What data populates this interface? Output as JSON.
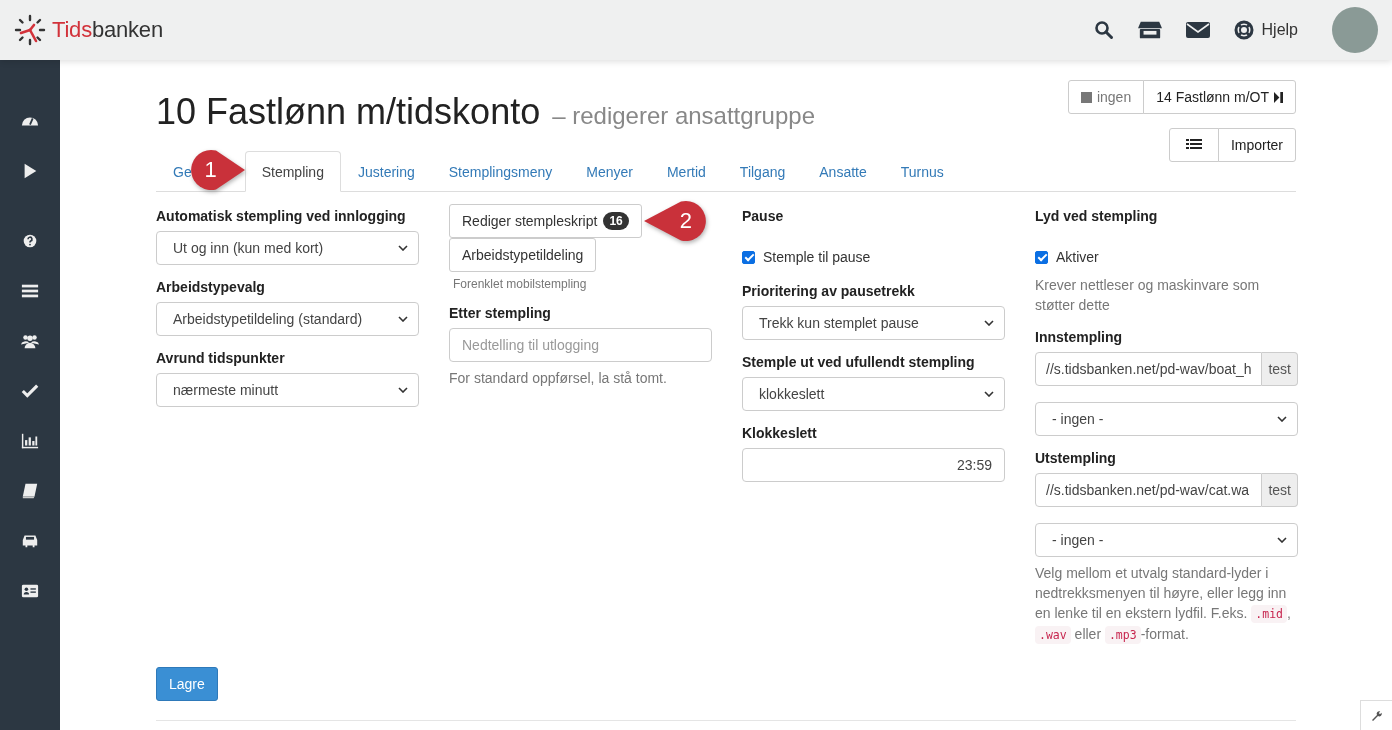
{
  "header": {
    "brand_first": "Tids",
    "brand_rest": "banken",
    "help": "Hjelp"
  },
  "page": {
    "title": "10 Fastlønn m/tidskonto",
    "subtitle": "– redigerer ansattgruppe",
    "prev": "ingen",
    "next": "14 Fastlønn m/OT",
    "import": "Importer"
  },
  "tabs": [
    {
      "label": "Ge",
      "selected": false
    },
    {
      "label": "Stempling",
      "selected": true
    },
    {
      "label": "Justering",
      "selected": false
    },
    {
      "label": "Stemplingsmeny",
      "selected": false
    },
    {
      "label": "Menyer",
      "selected": false
    },
    {
      "label": "Mertid",
      "selected": false
    },
    {
      "label": "Tilgang",
      "selected": false
    },
    {
      "label": "Ansatte",
      "selected": false
    },
    {
      "label": "Turnus",
      "selected": false
    }
  ],
  "callouts": [
    {
      "label": "1"
    },
    {
      "label": "2"
    }
  ],
  "columns": [
    [
      {
        "kind": "heading",
        "text": "Automatisk stempling ved innlogging"
      },
      {
        "kind": "select",
        "value": "Ut og inn (kun med kort)"
      },
      {
        "kind": "heading",
        "text": "Arbeidstypevalg"
      },
      {
        "kind": "select",
        "value": "Arbeidstypetildeling (standard)"
      },
      {
        "kind": "heading",
        "text": "Avrund tidspunkter"
      },
      {
        "kind": "select",
        "value": "nærmeste minutt"
      }
    ],
    [
      {
        "kind": "button",
        "label": "Rediger stempleskript",
        "badge": "16"
      },
      {
        "kind": "button",
        "label": "Arbeidstypetildeling"
      },
      {
        "kind": "small",
        "text": "Forenklet mobilstempling"
      },
      {
        "kind": "heading",
        "text": "Etter stempling"
      },
      {
        "kind": "input",
        "placeholder": "Nedtelling til utlogging"
      },
      {
        "kind": "note",
        "text": "For standard oppførsel, la stå tomt."
      }
    ],
    [
      {
        "kind": "heading",
        "text": "Pause"
      },
      {
        "kind": "checkbox",
        "label": "Stemple til pause",
        "checked": true
      },
      {
        "kind": "heading",
        "text": "Prioritering av pausetrekk"
      },
      {
        "kind": "select",
        "value": "Trekk kun stemplet pause"
      },
      {
        "kind": "heading",
        "text": "Stemple ut ved ufullendt stempling"
      },
      {
        "kind": "select",
        "value": "klokkeslett"
      },
      {
        "kind": "heading",
        "text": "Klokkeslett"
      },
      {
        "kind": "time",
        "value": "23:59"
      }
    ],
    [
      {
        "kind": "heading",
        "text": "Lyd ved stempling"
      },
      {
        "kind": "checkbox",
        "label": "Aktiver",
        "checked": true
      },
      {
        "kind": "note",
        "text": "Krever nettleser og maskinvare som støtter dette"
      },
      {
        "kind": "heading",
        "text": "Innstempling"
      },
      {
        "kind": "url",
        "value": "//s.tidsbanken.net/pd-wav/boat_h",
        "addon": "test"
      },
      {
        "kind": "select",
        "value": "- ingen -"
      },
      {
        "kind": "heading",
        "text": "Utstempling"
      },
      {
        "kind": "url",
        "value": "//s.tidsbanken.net/pd-wav/cat.wa",
        "addon": "test"
      },
      {
        "kind": "select",
        "value": "- ingen -"
      },
      {
        "kind": "parts",
        "parts": [
          {
            "kind": "text",
            "text": "Velg mellom et utvalg standard-lyder i nedtrekksmenyen til høyre, eller legg inn en lenke til en ekstern lydfil. F.eks. "
          },
          {
            "kind": "code",
            "text": ".mid"
          },
          {
            "kind": "text",
            "text": ", "
          },
          {
            "kind": "code",
            "text": ".wav"
          },
          {
            "kind": "text",
            "text": " eller "
          },
          {
            "kind": "code",
            "text": ".mp3"
          },
          {
            "kind": "text",
            "text": "-format."
          }
        ]
      }
    ]
  ],
  "save": "Lagre"
}
